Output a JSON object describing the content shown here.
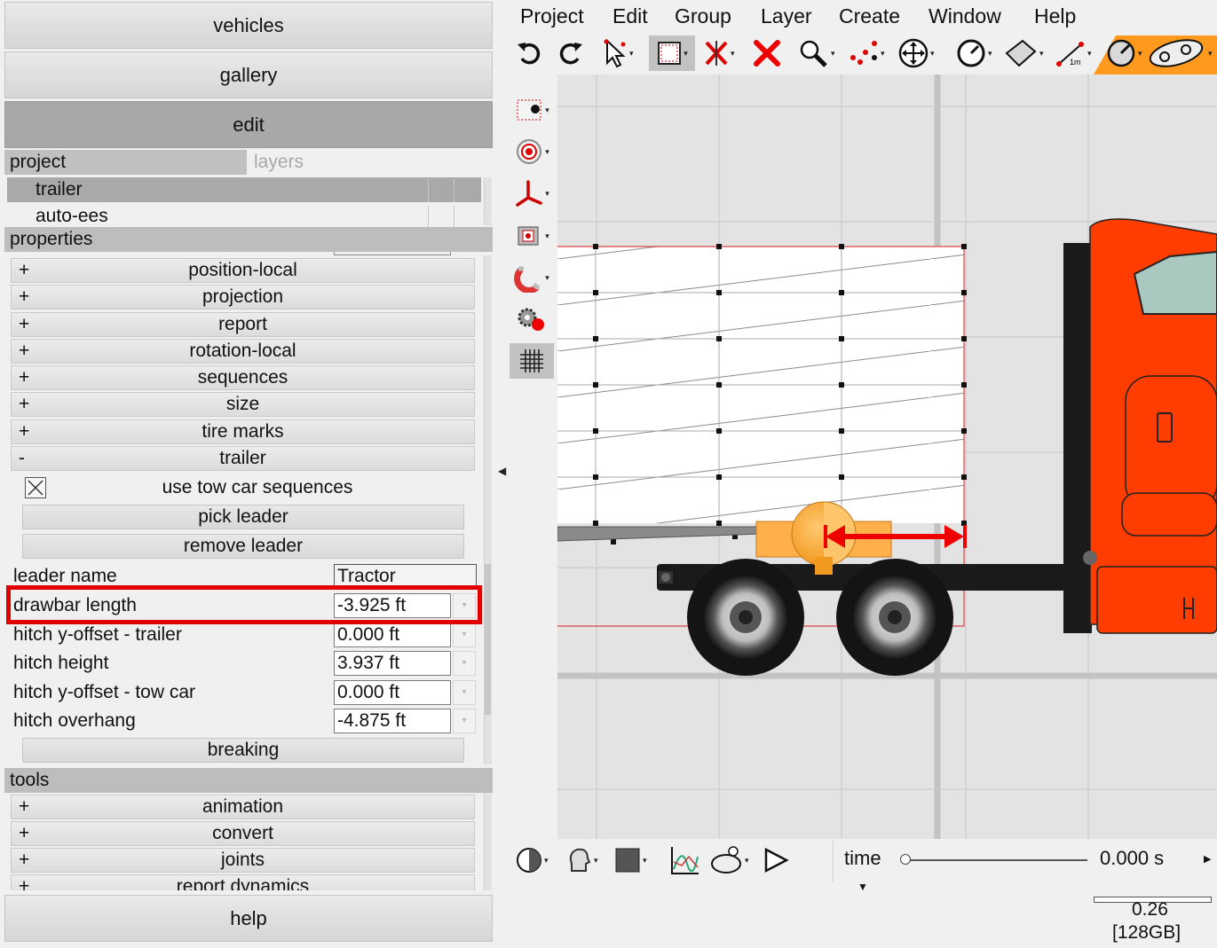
{
  "nav": {
    "vehicles": "vehicles",
    "gallery": "gallery",
    "edit": "edit",
    "help": "help"
  },
  "tabs": {
    "project": "project",
    "layers": "layers"
  },
  "layers": [
    "trailer",
    "auto-ees"
  ],
  "properties": {
    "header": "properties",
    "groups": [
      {
        "sign": "+",
        "label": "position-local"
      },
      {
        "sign": "+",
        "label": "projection"
      },
      {
        "sign": "+",
        "label": "report"
      },
      {
        "sign": "+",
        "label": "rotation-local"
      },
      {
        "sign": "+",
        "label": "sequences"
      },
      {
        "sign": "+",
        "label": "size"
      },
      {
        "sign": "+",
        "label": "tire marks"
      },
      {
        "sign": "-",
        "label": "trailer"
      }
    ],
    "trailer": {
      "use_tow_car_sequences": "use tow car sequences",
      "use_tow_car_sequences_checked": true,
      "pick_leader": "pick leader",
      "remove_leader": "remove leader",
      "fields": [
        {
          "label": "leader name",
          "value": "Tractor"
        },
        {
          "label": "drawbar length",
          "value": "-3.925 ft"
        },
        {
          "label": "hitch y-offset - trailer",
          "value": "0.000 ft"
        },
        {
          "label": "hitch height",
          "value": "3.937 ft"
        },
        {
          "label": "hitch y-offset - tow car",
          "value": "0.000 ft"
        },
        {
          "label": "hitch overhang",
          "value": "-4.875 ft"
        }
      ],
      "breaking": "breaking"
    }
  },
  "tools": {
    "header": "tools",
    "groups": [
      {
        "sign": "+",
        "label": "animation"
      },
      {
        "sign": "+",
        "label": "convert"
      },
      {
        "sign": "+",
        "label": "joints"
      },
      {
        "sign": "+",
        "label": "report dynamics"
      }
    ]
  },
  "menu": [
    "Project",
    "Edit",
    "Group",
    "Layer",
    "Create",
    "Window",
    "Help"
  ],
  "toolbar_icons": [
    "undo-icon",
    "redo-icon",
    "select-pointer-icon",
    "select-box-icon",
    "delete-points-icon",
    "delete-icon",
    "zoom-icon",
    "points-icon",
    "move-icon",
    "dial-icon",
    "surface-icon",
    "measure-icon",
    "gauge-icon",
    "vehicle-icon"
  ],
  "bottom": {
    "time_label": "time",
    "time_value": "0.000 s",
    "time_fraction": 0,
    "memory_value": "0.26",
    "memory_total": "[128GB]"
  },
  "colors": {
    "highlight": "#e00000",
    "cab": "#ff3d00",
    "hitch": "#ffa640",
    "accent_orange": "#ff9a1f"
  }
}
